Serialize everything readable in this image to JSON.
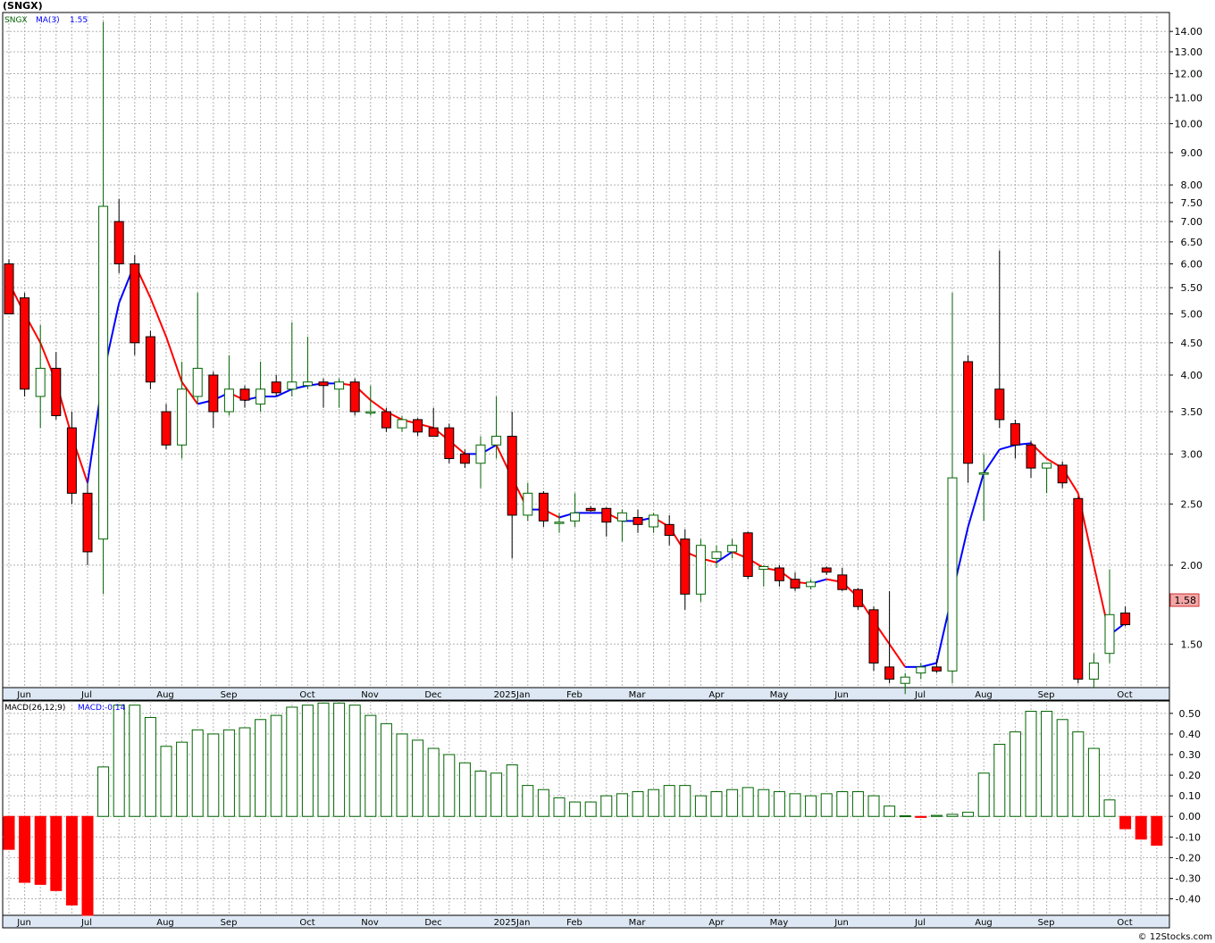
{
  "title": "(SNGX)",
  "legend": {
    "symbol": "SNGX",
    "ma_label": "MA(3)",
    "ma_value": "1.55"
  },
  "macd_legend": {
    "label": "MACD(26,12,9)",
    "value_label": "MACD:-0.14"
  },
  "last_price_label": "1.58",
  "credit": "© 12Stocks.com",
  "colors": {
    "up": "#006400",
    "down": "#ff0000",
    "ma": "#0000ff",
    "grid": "#b0b0b0",
    "axis_band": "#dde8f4"
  },
  "chart_data": [
    {
      "type": "candlestick",
      "symbol": "SNGX",
      "y_scale": "log",
      "ylim": [
        1.28,
        15.0
      ],
      "y_ticks": [
        "1.50",
        "2.00",
        "2.50",
        "3.00",
        "3.50",
        "4.00",
        "4.50",
        "5.00",
        "5.50",
        "6.00",
        "6.50",
        "7.00",
        "7.50",
        "8.00",
        "9.00",
        "10.00",
        "11.00",
        "12.00",
        "13.00",
        "14.00"
      ],
      "x_labels": [
        "Jun",
        "Jul",
        "Aug",
        "Sep",
        "Oct",
        "Nov",
        "Dec",
        "2025Jan",
        "Feb",
        "Mar",
        "Apr",
        "May",
        "Jun",
        "Jul",
        "Aug",
        "Sep",
        "Oct"
      ],
      "candles": [
        {
          "o": 6.0,
          "h": 6.1,
          "l": 5.0,
          "c": 5.0
        },
        {
          "o": 5.3,
          "h": 5.4,
          "l": 3.7,
          "c": 3.8
        },
        {
          "o": 3.7,
          "h": 4.8,
          "l": 3.3,
          "c": 4.1
        },
        {
          "o": 4.1,
          "h": 4.35,
          "l": 3.4,
          "c": 3.45
        },
        {
          "o": 3.3,
          "h": 3.5,
          "l": 2.5,
          "c": 2.6
        },
        {
          "o": 2.6,
          "h": 2.7,
          "l": 2.0,
          "c": 2.1
        },
        {
          "o": 2.2,
          "h": 14.5,
          "l": 1.8,
          "c": 7.4
        },
        {
          "o": 7.0,
          "h": 7.6,
          "l": 5.8,
          "c": 6.0
        },
        {
          "o": 6.0,
          "h": 6.2,
          "l": 4.3,
          "c": 4.5
        },
        {
          "o": 4.6,
          "h": 4.7,
          "l": 3.8,
          "c": 3.9
        },
        {
          "o": 3.5,
          "h": 3.6,
          "l": 3.05,
          "c": 3.1
        },
        {
          "o": 3.1,
          "h": 4.2,
          "l": 2.95,
          "c": 3.8
        },
        {
          "o": 3.7,
          "h": 5.4,
          "l": 3.6,
          "c": 4.1
        },
        {
          "o": 4.0,
          "h": 4.05,
          "l": 3.3,
          "c": 3.5
        },
        {
          "o": 3.5,
          "h": 4.3,
          "l": 3.45,
          "c": 3.8
        },
        {
          "o": 3.8,
          "h": 3.85,
          "l": 3.55,
          "c": 3.65
        },
        {
          "o": 3.6,
          "h": 4.2,
          "l": 3.5,
          "c": 3.8
        },
        {
          "o": 3.9,
          "h": 4.0,
          "l": 3.7,
          "c": 3.75
        },
        {
          "o": 3.8,
          "h": 4.85,
          "l": 3.7,
          "c": 3.9
        },
        {
          "o": 3.85,
          "h": 4.6,
          "l": 3.8,
          "c": 3.9
        },
        {
          "o": 3.9,
          "h": 3.95,
          "l": 3.55,
          "c": 3.85
        },
        {
          "o": 3.8,
          "h": 3.95,
          "l": 3.55,
          "c": 3.9
        },
        {
          "o": 3.9,
          "h": 3.95,
          "l": 3.45,
          "c": 3.5
        },
        {
          "o": 3.5,
          "h": 3.85,
          "l": 3.45,
          "c": 3.5
        },
        {
          "o": 3.5,
          "h": 3.55,
          "l": 3.25,
          "c": 3.3
        },
        {
          "o": 3.3,
          "h": 3.45,
          "l": 3.25,
          "c": 3.4
        },
        {
          "o": 3.4,
          "h": 3.42,
          "l": 3.2,
          "c": 3.25
        },
        {
          "o": 3.3,
          "h": 3.55,
          "l": 3.2,
          "c": 3.2
        },
        {
          "o": 3.3,
          "h": 3.35,
          "l": 2.9,
          "c": 2.95
        },
        {
          "o": 3.0,
          "h": 3.05,
          "l": 2.85,
          "c": 2.9
        },
        {
          "o": 2.9,
          "h": 3.2,
          "l": 2.65,
          "c": 3.1
        },
        {
          "o": 3.1,
          "h": 3.7,
          "l": 2.95,
          "c": 3.2
        },
        {
          "o": 3.2,
          "h": 3.5,
          "l": 2.05,
          "c": 2.4
        },
        {
          "o": 2.4,
          "h": 2.7,
          "l": 2.35,
          "c": 2.6
        },
        {
          "o": 2.6,
          "h": 2.62,
          "l": 2.3,
          "c": 2.35
        },
        {
          "o": 2.34,
          "h": 2.42,
          "l": 2.25,
          "c": 2.34
        },
        {
          "o": 2.35,
          "h": 2.6,
          "l": 2.3,
          "c": 2.42
        },
        {
          "o": 2.46,
          "h": 2.48,
          "l": 2.43,
          "c": 2.44
        },
        {
          "o": 2.46,
          "h": 2.47,
          "l": 2.22,
          "c": 2.34
        },
        {
          "o": 2.35,
          "h": 2.45,
          "l": 2.18,
          "c": 2.42
        },
        {
          "o": 2.38,
          "h": 2.45,
          "l": 2.25,
          "c": 2.32
        },
        {
          "o": 2.3,
          "h": 2.42,
          "l": 2.25,
          "c": 2.4
        },
        {
          "o": 2.32,
          "h": 2.4,
          "l": 2.15,
          "c": 2.23
        },
        {
          "o": 2.2,
          "h": 2.28,
          "l": 1.7,
          "c": 1.8
        },
        {
          "o": 1.8,
          "h": 2.2,
          "l": 1.75,
          "c": 2.15
        },
        {
          "o": 2.05,
          "h": 2.15,
          "l": 1.98,
          "c": 2.1
        },
        {
          "o": 2.1,
          "h": 2.2,
          "l": 2.05,
          "c": 2.15
        },
        {
          "o": 2.25,
          "h": 2.26,
          "l": 1.9,
          "c": 1.92
        },
        {
          "o": 1.97,
          "h": 2.0,
          "l": 1.85,
          "c": 1.99
        },
        {
          "o": 1.98,
          "h": 2.0,
          "l": 1.85,
          "c": 1.89
        },
        {
          "o": 1.9,
          "h": 1.95,
          "l": 1.82,
          "c": 1.84
        },
        {
          "o": 1.85,
          "h": 1.9,
          "l": 1.83,
          "c": 1.88
        },
        {
          "o": 1.98,
          "h": 1.99,
          "l": 1.93,
          "c": 1.95
        },
        {
          "o": 1.93,
          "h": 1.98,
          "l": 1.82,
          "c": 1.83
        },
        {
          "o": 1.83,
          "h": 1.84,
          "l": 1.7,
          "c": 1.72
        },
        {
          "o": 1.7,
          "h": 1.72,
          "l": 1.36,
          "c": 1.4
        },
        {
          "o": 1.38,
          "h": 1.82,
          "l": 1.3,
          "c": 1.32
        },
        {
          "o": 1.3,
          "h": 1.35,
          "l": 1.25,
          "c": 1.33
        },
        {
          "o": 1.35,
          "h": 1.4,
          "l": 1.32,
          "c": 1.38
        },
        {
          "o": 1.38,
          "h": 1.42,
          "l": 1.35,
          "c": 1.36
        },
        {
          "o": 1.36,
          "h": 5.4,
          "l": 1.3,
          "c": 2.75
        },
        {
          "o": 4.2,
          "h": 4.3,
          "l": 2.7,
          "c": 2.9
        },
        {
          "o": 2.8,
          "h": 3.0,
          "l": 2.35,
          "c": 2.8
        },
        {
          "o": 3.8,
          "h": 6.3,
          "l": 3.3,
          "c": 3.4
        },
        {
          "o": 3.35,
          "h": 3.4,
          "l": 2.95,
          "c": 3.1
        },
        {
          "o": 3.1,
          "h": 3.15,
          "l": 2.75,
          "c": 2.85
        },
        {
          "o": 2.85,
          "h": 2.9,
          "l": 2.6,
          "c": 2.9
        },
        {
          "o": 2.88,
          "h": 2.92,
          "l": 2.65,
          "c": 2.7
        },
        {
          "o": 2.55,
          "h": 2.57,
          "l": 1.3,
          "c": 1.32
        },
        {
          "o": 1.32,
          "h": 1.45,
          "l": 1.28,
          "c": 1.4
        },
        {
          "o": 1.45,
          "h": 1.97,
          "l": 1.4,
          "c": 1.67
        },
        {
          "o": 1.68,
          "h": 1.72,
          "l": 1.6,
          "c": 1.61
        }
      ],
      "ma3": [
        5.6,
        5.0,
        4.5,
        3.9,
        3.2,
        2.7,
        4.0,
        5.2,
        6.0,
        5.3,
        4.6,
        3.9,
        3.6,
        3.65,
        3.75,
        3.65,
        3.7,
        3.7,
        3.8,
        3.85,
        3.88,
        3.88,
        3.85,
        3.65,
        3.5,
        3.4,
        3.35,
        3.3,
        3.15,
        3.0,
        3.0,
        3.1,
        2.75,
        2.45,
        2.45,
        2.38,
        2.42,
        2.42,
        2.42,
        2.35,
        2.35,
        2.38,
        2.3,
        2.1,
        2.05,
        2.02,
        2.1,
        2.05,
        1.98,
        1.96,
        1.88,
        1.87,
        1.9,
        1.88,
        1.78,
        1.63,
        1.5,
        1.38,
        1.38,
        1.4,
        1.8,
        2.3,
        2.8,
        3.05,
        3.1,
        3.12,
        2.95,
        2.85,
        2.6,
        2.0,
        1.55,
        1.62
      ],
      "ma3_label": "MA(3)"
    },
    {
      "type": "bar",
      "name": "MACD(26,12,9)",
      "ylim": [
        -0.48,
        0.56
      ],
      "y_ticks": [
        -0.4,
        -0.3,
        -0.2,
        -0.1,
        0.0,
        0.1,
        0.2,
        0.3,
        0.4,
        0.5
      ],
      "values": [
        -0.16,
        -0.32,
        -0.33,
        -0.36,
        -0.43,
        -0.48,
        0.24,
        0.54,
        0.54,
        0.48,
        0.34,
        0.36,
        0.42,
        0.4,
        0.42,
        0.43,
        0.47,
        0.49,
        0.53,
        0.54,
        0.55,
        0.55,
        0.54,
        0.49,
        0.45,
        0.4,
        0.37,
        0.33,
        0.3,
        0.26,
        0.22,
        0.21,
        0.25,
        0.15,
        0.13,
        0.09,
        0.07,
        0.07,
        0.1,
        0.11,
        0.12,
        0.13,
        0.15,
        0.15,
        0.1,
        0.12,
        0.13,
        0.14,
        0.13,
        0.12,
        0.11,
        0.1,
        0.11,
        0.12,
        0.12,
        0.1,
        0.05,
        0.003,
        -0.005,
        0.005,
        0.01,
        0.02,
        0.21,
        0.35,
        0.41,
        0.51,
        0.51,
        0.47,
        0.41,
        0.33,
        0.08,
        -0.06,
        -0.11,
        -0.14
      ]
    }
  ]
}
